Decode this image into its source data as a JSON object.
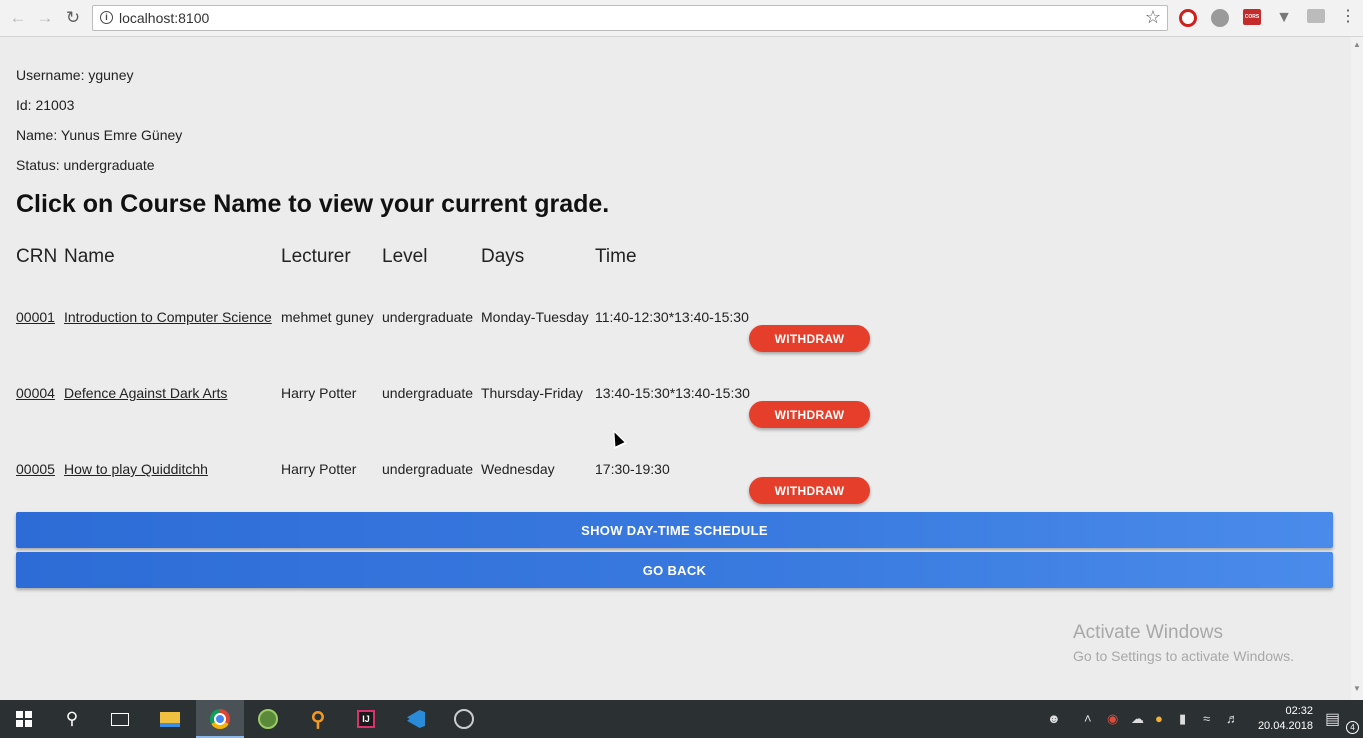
{
  "browser": {
    "url": "localhost:8100",
    "icons": [
      "back-arrow",
      "forward-arrow",
      "reload",
      "info",
      "star",
      "opera",
      "globe",
      "cors",
      "vpn",
      "grid",
      "menu"
    ]
  },
  "user": {
    "username_line": "Username: yguney",
    "id_line": "Id: 21003",
    "name_line": "Name: Yunus Emre Güney",
    "status_line": "Status: undergraduate"
  },
  "headline": "Click on Course Name to view your current grade.",
  "table": {
    "headers": [
      "CRN",
      "Name",
      "Lecturer",
      "Level",
      "Days",
      "Time"
    ],
    "rows": [
      {
        "crn": "00001",
        "name": "Introduction to Computer Science",
        "lecturer": "mehmet guney",
        "level": "undergraduate",
        "days": "Monday-Tuesday",
        "time": "11:40-12:30*13:40-15:30",
        "action": "WITHDRAW"
      },
      {
        "crn": "00004",
        "name": "Defence Against Dark Arts",
        "lecturer": "Harry Potter",
        "level": "undergraduate",
        "days": "Thursday-Friday",
        "time": "13:40-15:30*13:40-15:30",
        "action": "WITHDRAW"
      },
      {
        "crn": "00005",
        "name": "How to play Quidditchh",
        "lecturer": "Harry Potter",
        "level": "undergraduate",
        "days": "Wednesday",
        "time": "17:30-19:30",
        "action": "WITHDRAW"
      }
    ]
  },
  "buttons": {
    "schedule": "SHOW DAY-TIME SCHEDULE",
    "back": "GO BACK"
  },
  "watermark": {
    "title": "Activate Windows",
    "subtitle": "Go to Settings to activate Windows."
  },
  "taskbar": {
    "time": "02:32",
    "date": "20.04.2018",
    "notifications": "4"
  },
  "colors": {
    "withdraw": "#e53f2b",
    "primary": "#3a7be0",
    "taskbar": "#2b3033"
  }
}
